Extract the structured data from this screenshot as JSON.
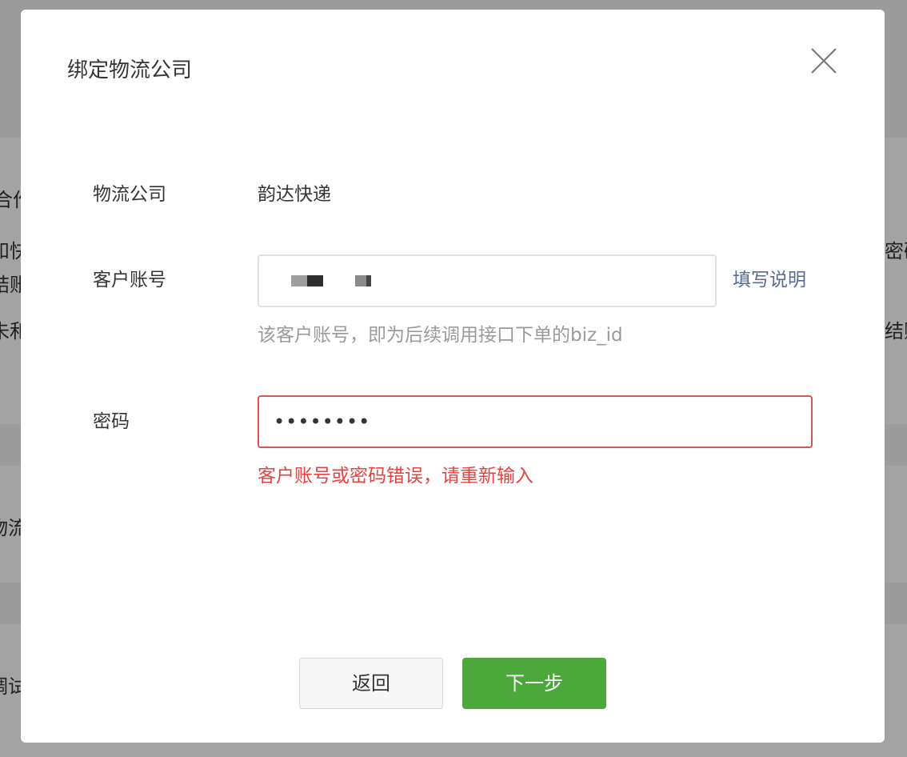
{
  "background": {
    "fragments": [
      "合作",
      "和快",
      "结账",
      "未和",
      "物流",
      "调试",
      "密码",
      "结账"
    ]
  },
  "modal": {
    "title": "绑定物流公司"
  },
  "form": {
    "company_label": "物流公司",
    "company_value": "韵达快递",
    "account_label": "客户账号",
    "account_help_link": "填写说明",
    "account_hint": "该客户账号，即为后续调用接口下单的biz_id",
    "password_label": "密码",
    "password_value": "••••••••",
    "error_message": "客户账号或密码错误，请重新输入"
  },
  "buttons": {
    "back": "返回",
    "next": "下一步"
  },
  "colors": {
    "primary": "#4ca83a",
    "error": "#e64340",
    "link": "#576b95",
    "error_border": "#e15050"
  },
  "icons": {
    "close": "close-icon"
  }
}
